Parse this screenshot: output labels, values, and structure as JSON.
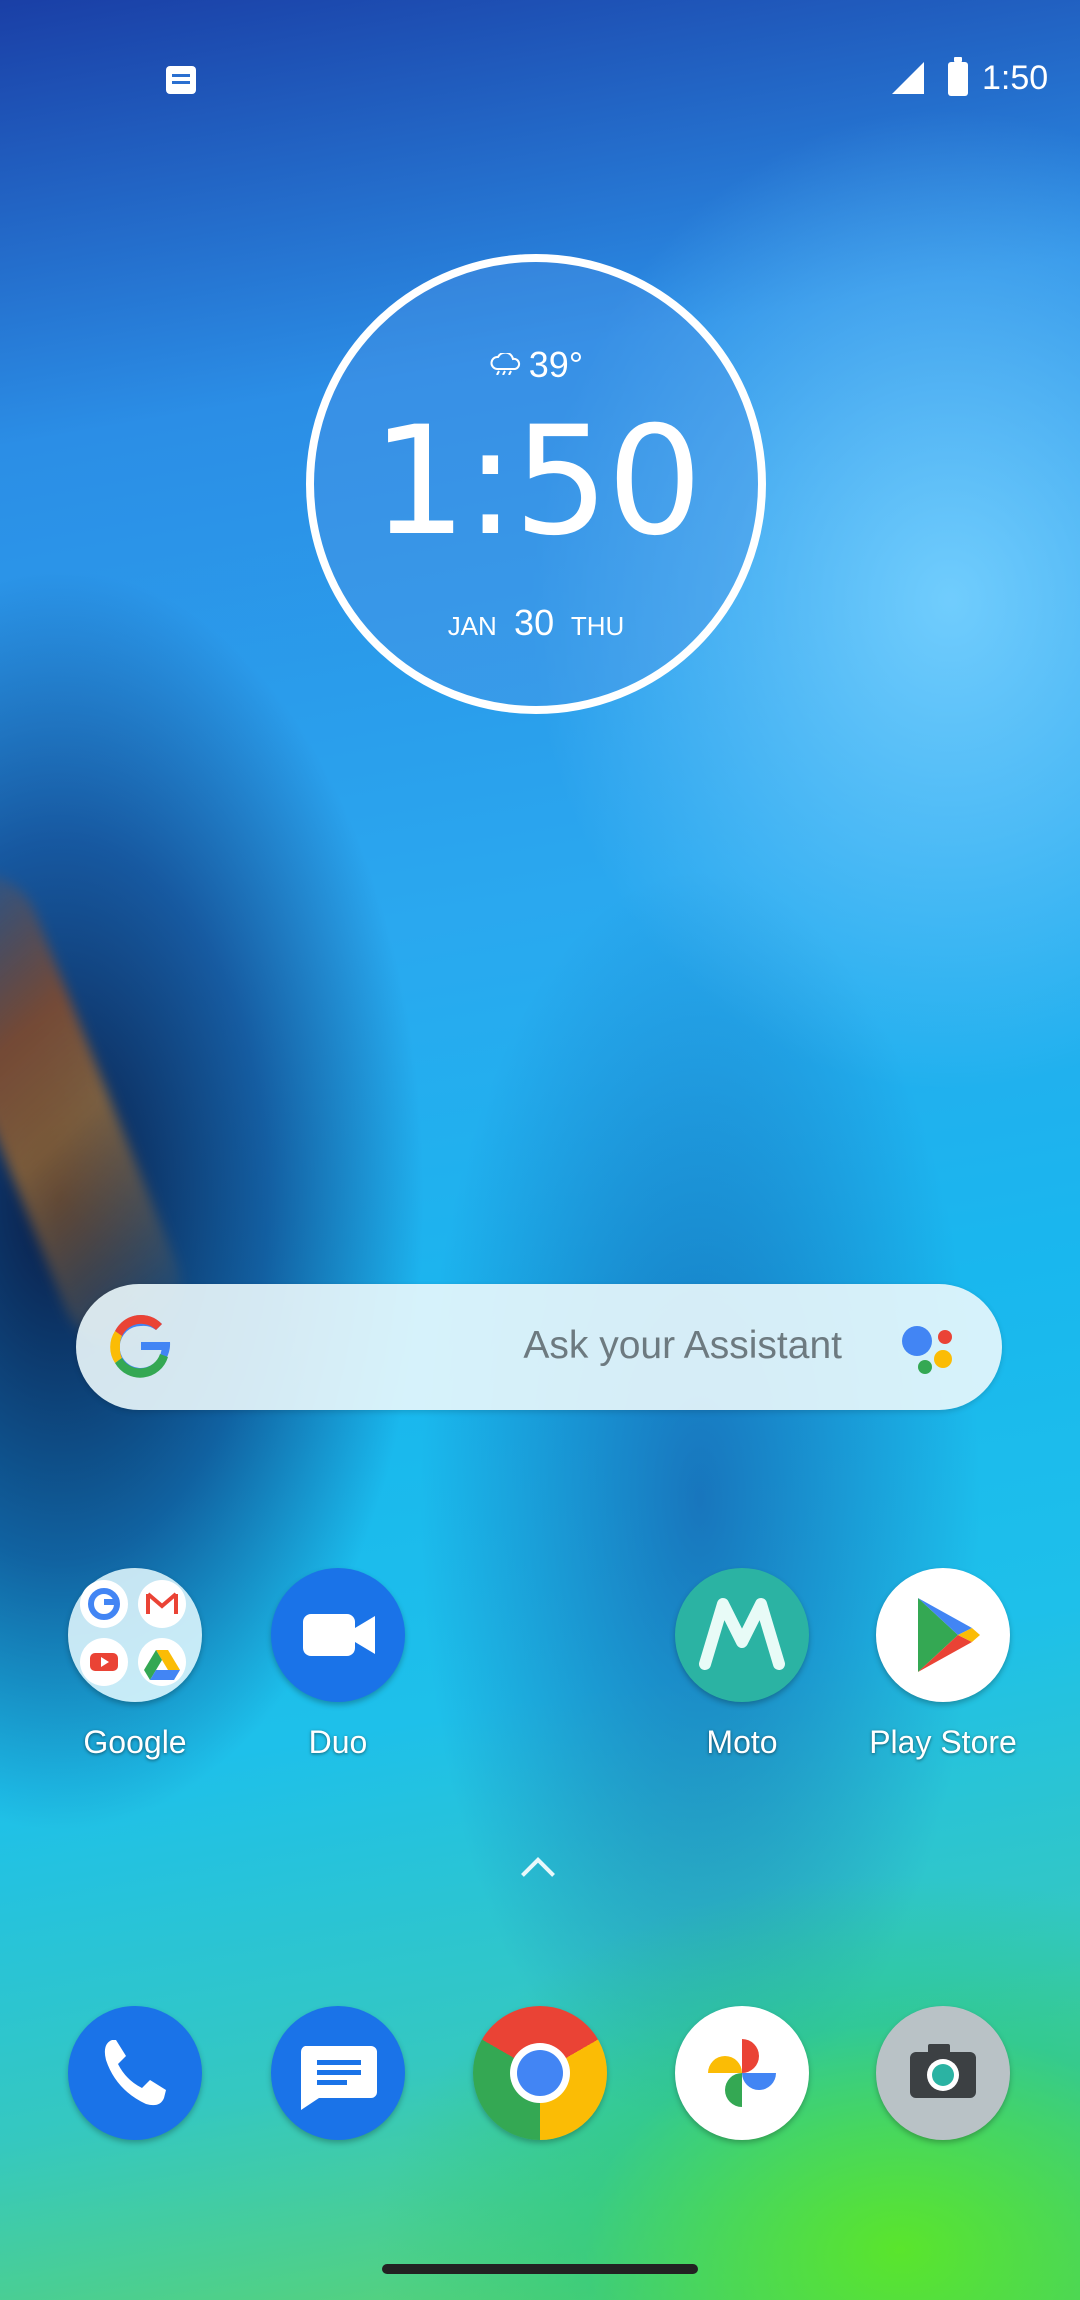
{
  "status_bar": {
    "time": "1:50",
    "notification_icon": "messages-notification-icon",
    "signal_icon": "cell-signal-icon",
    "battery_icon": "battery-icon"
  },
  "clock_widget": {
    "weather_icon": "rain-cloud-icon",
    "temperature": "39°",
    "time": "1:50",
    "month": "JAN",
    "day": "30",
    "weekday": "THU"
  },
  "search_bar": {
    "placeholder": "Ask your Assistant",
    "logo_icon": "google-g-icon",
    "assistant_icon": "google-assistant-icon"
  },
  "home_apps": [
    {
      "label": "Google",
      "icon": "google-folder-icon"
    },
    {
      "label": "Duo",
      "icon": "duo-video-icon"
    },
    {
      "label": "Moto",
      "icon": "motorola-icon"
    },
    {
      "label": "Play Store",
      "icon": "play-store-icon"
    }
  ],
  "dock": [
    {
      "name": "Phone",
      "icon": "phone-icon"
    },
    {
      "name": "Messages",
      "icon": "messages-icon"
    },
    {
      "name": "Chrome",
      "icon": "chrome-icon"
    },
    {
      "name": "Photos",
      "icon": "photos-pinwheel-icon"
    },
    {
      "name": "Camera",
      "icon": "camera-icon"
    }
  ],
  "colors": {
    "google_blue": "#4285F4",
    "google_red": "#EA4335",
    "google_yellow": "#FBBC05",
    "google_green": "#34A853",
    "duo_blue": "#1A73E8",
    "moto_teal": "#2BB3A3"
  }
}
